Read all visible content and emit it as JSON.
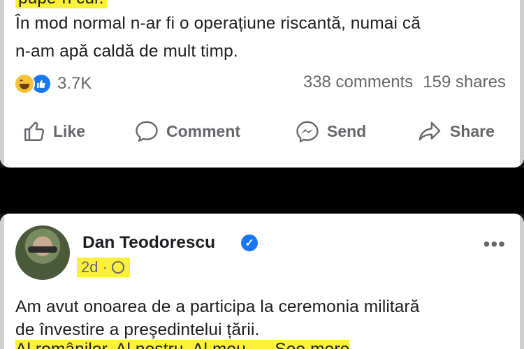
{
  "post1": {
    "cut_line": "pupe-n cur.",
    "body_lines": [
      "În mod normal n-ar fi o operațiune riscantă, numai că",
      "n-am apă caldă de mult timp."
    ],
    "reactions": {
      "icons": [
        "haha-icon",
        "like-icon"
      ],
      "count": "3.7K"
    },
    "comments": "338 comments",
    "shares": "159 shares",
    "actions": {
      "like": "Like",
      "comment": "Comment",
      "send": "Send",
      "share": "Share"
    }
  },
  "post2": {
    "author": "Dan Teodorescu",
    "time": "2d",
    "dot": "·",
    "body_lines": [
      "Am avut onoarea de a participa la ceremonia militară",
      "de învestire a preşedintelui țării."
    ],
    "cut_line": "Al românilor. Al nostru. Al meu. ... See more"
  },
  "colors": {
    "highlight": "#fcf13a",
    "link_blue": "#1877f2",
    "muted": "#65676b"
  }
}
